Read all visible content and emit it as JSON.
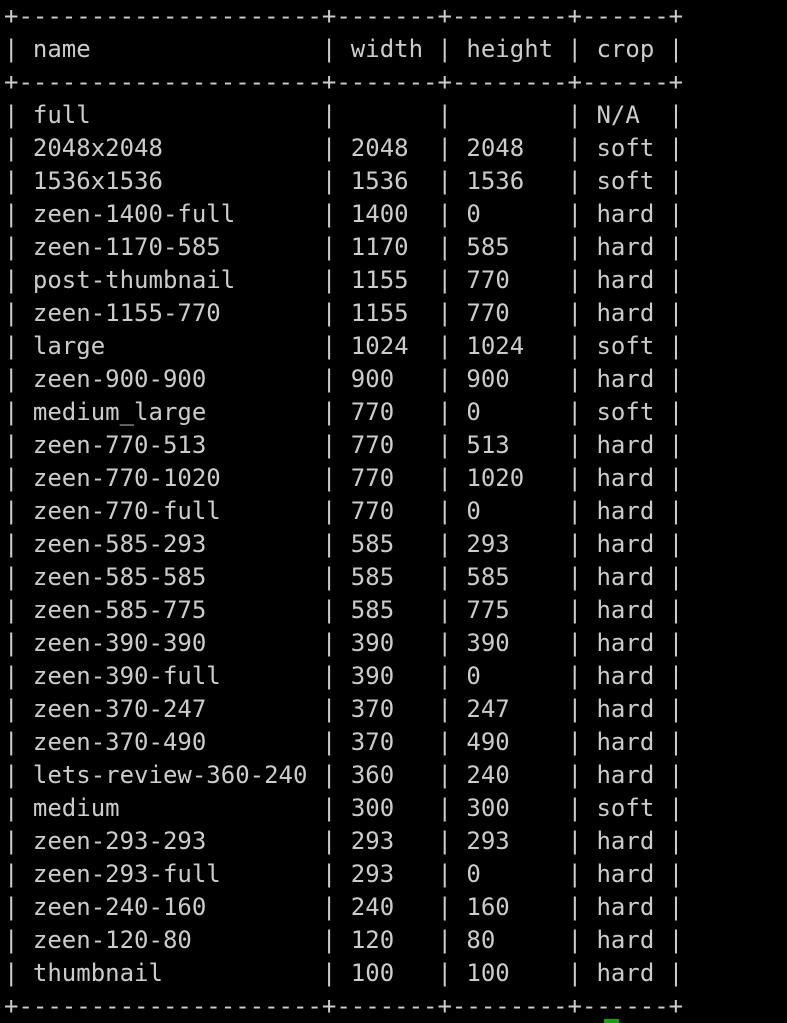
{
  "terminal": {
    "columns": [
      {
        "key": "name",
        "label": "name",
        "width": 21
      },
      {
        "key": "width",
        "label": "width",
        "width": 7
      },
      {
        "key": "height",
        "label": "height",
        "width": 8
      },
      {
        "key": "crop",
        "label": "crop",
        "width": 6
      }
    ],
    "rows": [
      {
        "name": "full",
        "width": "",
        "height": "",
        "crop": "N/A"
      },
      {
        "name": "2048x2048",
        "width": "2048",
        "height": "2048",
        "crop": "soft"
      },
      {
        "name": "1536x1536",
        "width": "1536",
        "height": "1536",
        "crop": "soft"
      },
      {
        "name": "zeen-1400-full",
        "width": "1400",
        "height": "0",
        "crop": "hard"
      },
      {
        "name": "zeen-1170-585",
        "width": "1170",
        "height": "585",
        "crop": "hard"
      },
      {
        "name": "post-thumbnail",
        "width": "1155",
        "height": "770",
        "crop": "hard"
      },
      {
        "name": "zeen-1155-770",
        "width": "1155",
        "height": "770",
        "crop": "hard"
      },
      {
        "name": "large",
        "width": "1024",
        "height": "1024",
        "crop": "soft"
      },
      {
        "name": "zeen-900-900",
        "width": "900",
        "height": "900",
        "crop": "hard"
      },
      {
        "name": "medium_large",
        "width": "770",
        "height": "0",
        "crop": "soft"
      },
      {
        "name": "zeen-770-513",
        "width": "770",
        "height": "513",
        "crop": "hard"
      },
      {
        "name": "zeen-770-1020",
        "width": "770",
        "height": "1020",
        "crop": "hard"
      },
      {
        "name": "zeen-770-full",
        "width": "770",
        "height": "0",
        "crop": "hard"
      },
      {
        "name": "zeen-585-293",
        "width": "585",
        "height": "293",
        "crop": "hard"
      },
      {
        "name": "zeen-585-585",
        "width": "585",
        "height": "585",
        "crop": "hard"
      },
      {
        "name": "zeen-585-775",
        "width": "585",
        "height": "775",
        "crop": "hard"
      },
      {
        "name": "zeen-390-390",
        "width": "390",
        "height": "390",
        "crop": "hard"
      },
      {
        "name": "zeen-390-full",
        "width": "390",
        "height": "0",
        "crop": "hard"
      },
      {
        "name": "zeen-370-247",
        "width": "370",
        "height": "247",
        "crop": "hard"
      },
      {
        "name": "zeen-370-490",
        "width": "370",
        "height": "490",
        "crop": "hard"
      },
      {
        "name": "lets-review-360-240",
        "width": "360",
        "height": "240",
        "crop": "hard"
      },
      {
        "name": "medium",
        "width": "300",
        "height": "300",
        "crop": "soft"
      },
      {
        "name": "zeen-293-293",
        "width": "293",
        "height": "293",
        "crop": "hard"
      },
      {
        "name": "zeen-293-full",
        "width": "293",
        "height": "0",
        "crop": "hard"
      },
      {
        "name": "zeen-240-160",
        "width": "240",
        "height": "160",
        "crop": "hard"
      },
      {
        "name": "zeen-120-80",
        "width": "120",
        "height": "80",
        "crop": "hard"
      },
      {
        "name": "thumbnail",
        "width": "100",
        "height": "100",
        "crop": "hard"
      }
    ],
    "colors": {
      "background": "#000000",
      "text": "#cccccc",
      "cursor": "#13a10e"
    }
  }
}
